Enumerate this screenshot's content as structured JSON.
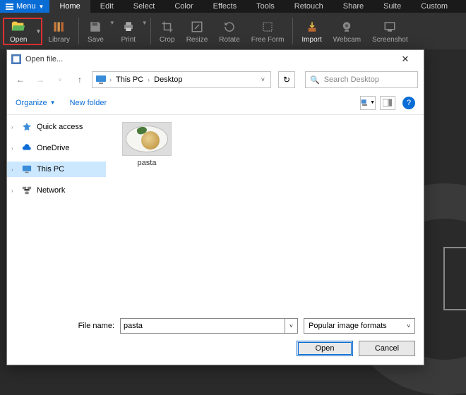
{
  "menubar": {
    "menu_label": "Menu",
    "tabs": [
      "Home",
      "Edit",
      "Select",
      "Color",
      "Effects",
      "Tools",
      "Retouch",
      "Share",
      "Suite",
      "Custom"
    ]
  },
  "ribbon": {
    "open": "Open",
    "library": "Library",
    "save": "Save",
    "print": "Print",
    "crop": "Crop",
    "resize": "Resize",
    "rotate": "Rotate",
    "freeform": "Free Form",
    "import": "Import",
    "webcam": "Webcam",
    "screenshot": "Screenshot"
  },
  "dialog": {
    "title": "Open file...",
    "breadcrumb": [
      "This PC",
      "Desktop"
    ],
    "search_placeholder": "Search Desktop",
    "organize": "Organize",
    "newfolder": "New folder",
    "sidebar": {
      "quick": "Quick access",
      "onedrive": "OneDrive",
      "thispc": "This PC",
      "network": "Network"
    },
    "file": {
      "name": "pasta"
    },
    "filename_label": "File name:",
    "filename_value": "pasta",
    "filter": "Popular image formats",
    "open_btn": "Open",
    "cancel_btn": "Cancel"
  }
}
